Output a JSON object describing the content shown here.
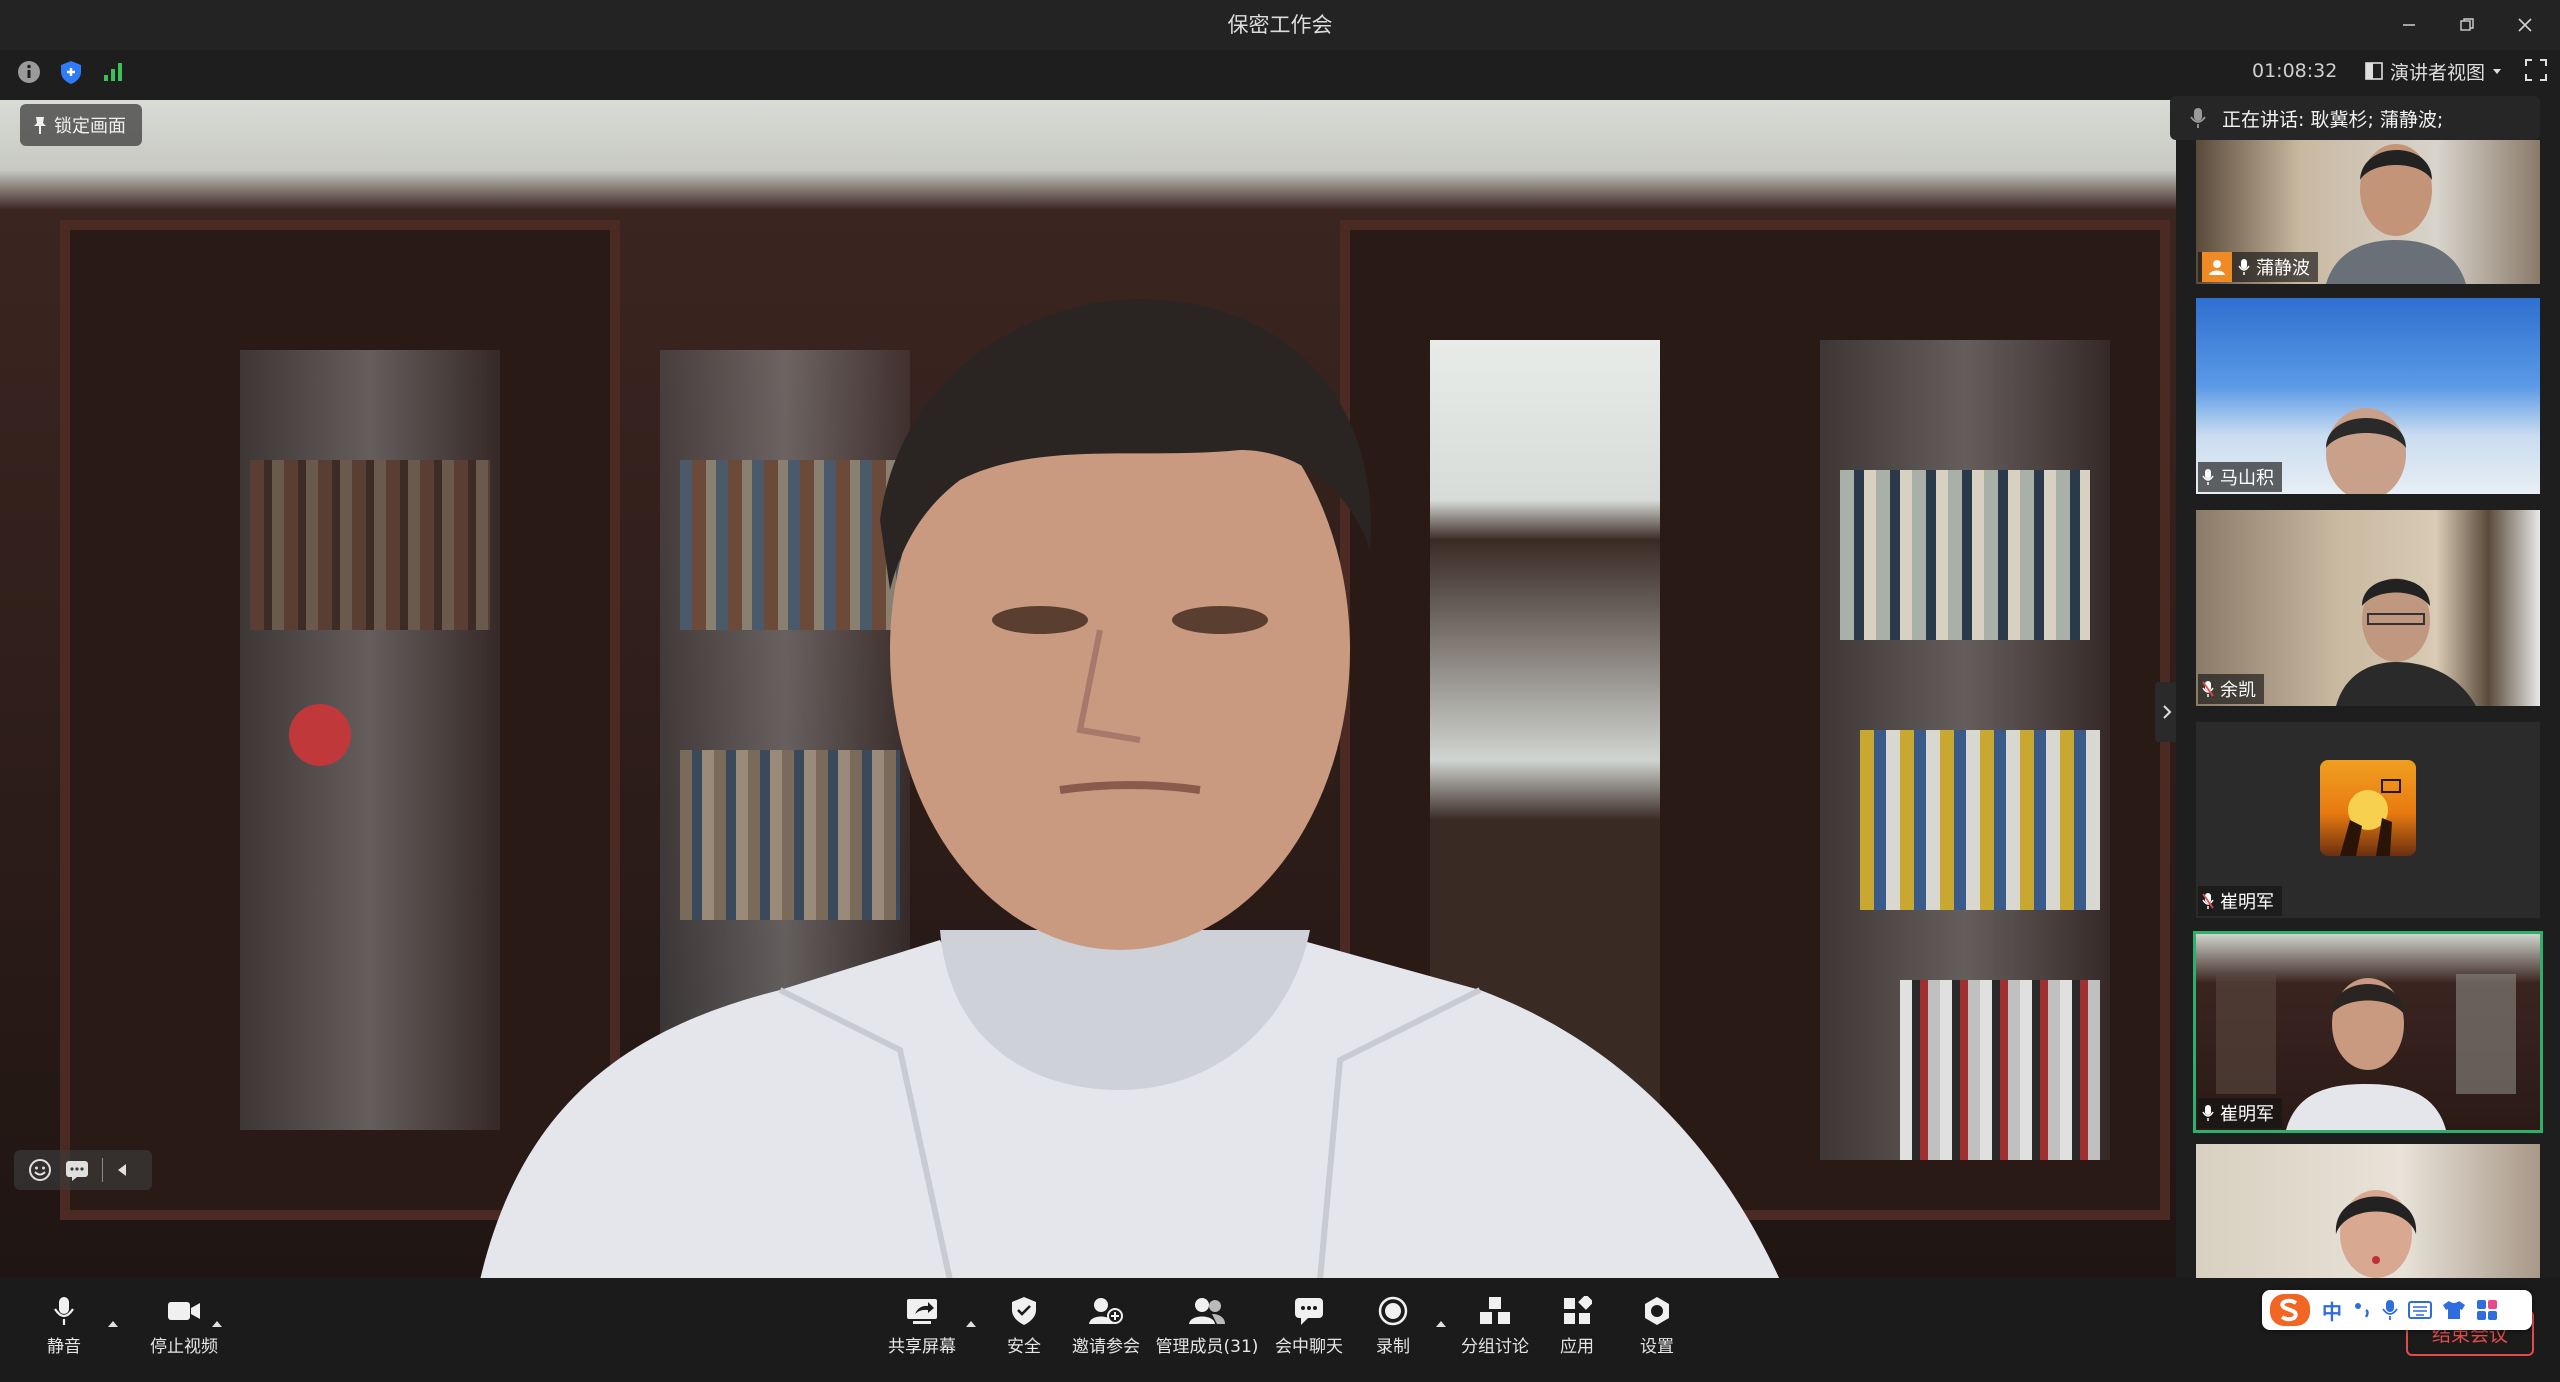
{
  "window": {
    "title": "保密工作会"
  },
  "infobar": {
    "timer": "01:08:32",
    "view_label": "演讲者视图"
  },
  "main": {
    "lock_label": "锁定画面"
  },
  "speaking": {
    "text": "正在讲话: 耿冀杉; 蒲静波;"
  },
  "participants": [
    {
      "name": "蒲静波",
      "host": true
    },
    {
      "name": "马山积"
    },
    {
      "name": "余凯"
    },
    {
      "name": "崔明军",
      "video_off": true
    },
    {
      "name": "崔明军",
      "active": true
    },
    {
      "name": ""
    }
  ],
  "toolbar": {
    "mute": "静音",
    "stop_video": "停止视频",
    "share": "共享屏幕",
    "security": "安全",
    "invite": "邀请参会",
    "manage": "管理成员(31)",
    "chat": "会中聊天",
    "record": "录制",
    "breakout": "分组讨论",
    "apps": "应用",
    "settings": "设置",
    "end": "结束会议"
  },
  "ime": {
    "mode": "中"
  },
  "colors": {
    "active_border": "#2fae6c",
    "host_badge": "#f08a24",
    "end_red": "#e24b4b",
    "signal_green": "#3cc157",
    "shield_blue": "#2f7cf6"
  }
}
